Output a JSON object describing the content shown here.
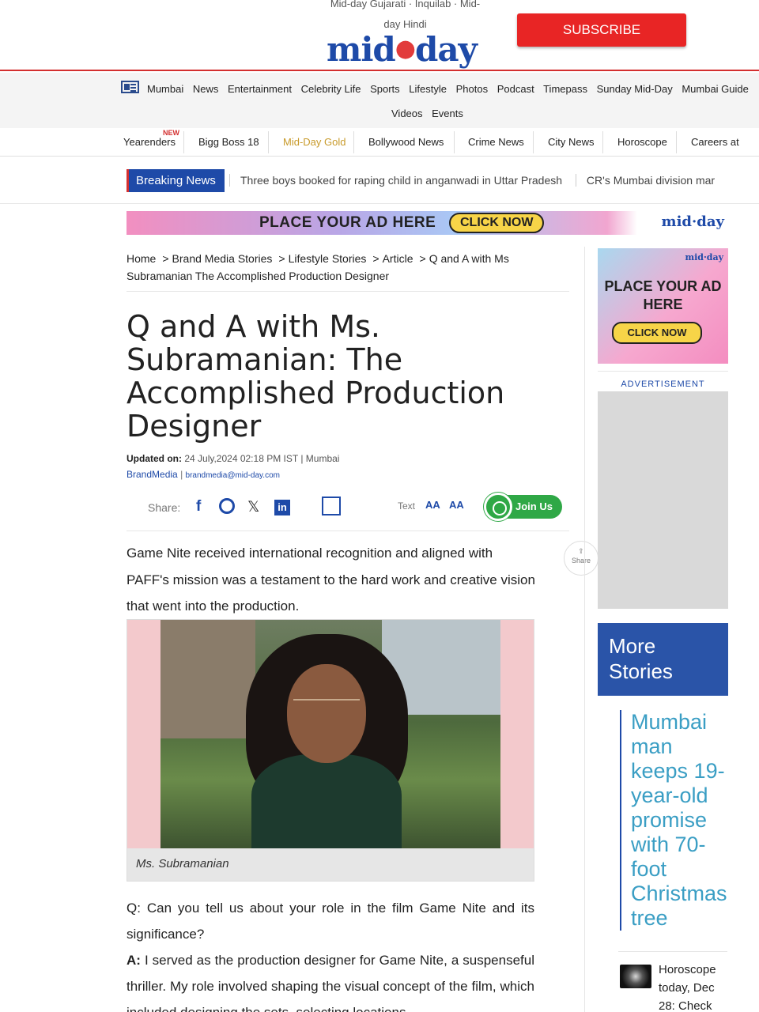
{
  "header": {
    "top_links": "Mid-day Gujarati · Inquilab · Mid-day Hindi",
    "logo_left": "mid",
    "logo_right": "day",
    "subscribe": "SUBSCRIBE"
  },
  "nav_primary": [
    "Mumbai",
    "News",
    "Entertainment",
    "Celebrity Life",
    "Sports",
    "Lifestyle",
    "Photos",
    "Podcast",
    "Timepass",
    "Sunday Mid-Day",
    "Mumbai Guide"
  ],
  "nav_primary_row2": [
    "Videos",
    "Events"
  ],
  "nav_secondary": {
    "new_badge": "NEW",
    "items": [
      "Yearenders",
      "Bigg Boss 18",
      "Mid-Day Gold",
      "Bollywood News",
      "Crime News",
      "City News",
      "Horoscope",
      "Careers at"
    ]
  },
  "breaking": {
    "label": "Breaking News",
    "items": [
      "Three boys booked for raping child in anganwadi in Uttar Pradesh",
      "CR's Mumbai division mar"
    ]
  },
  "ad_banner": {
    "text": "PLACE YOUR AD HERE",
    "cta": "CLICK NOW",
    "brand": "mid·day"
  },
  "breadcrumb": [
    "Home",
    "Brand Media Stories",
    "Lifestyle Stories",
    "Article",
    "Q and A with Ms Subramanian The Accomplished Production Designer"
  ],
  "article": {
    "title": "Q and A with Ms. Subramanian: The Accomplished Production Designer",
    "updated_label": "Updated on:",
    "updated_value": "24 July,2024 02:18 PM IST",
    "location": "Mumbai",
    "author": "BrandMedia",
    "author_email": "brandmedia@mid-day.com",
    "share_label": "Share:",
    "text_label": "Text",
    "font_small": "AA",
    "font_large": "AA",
    "join_label": "Join Us",
    "side_share": "Share",
    "lead": "Game Nite received international recognition and aligned with PAFF's mission was a testament to the hard work and creative vision that went into the production.",
    "caption": "Ms. Subramanian",
    "question": "Q: Can you tell us about your role in the film Game Nite and its significance?",
    "answer_label": "A:",
    "answer": "I served as the production designer for Game Nite, a suspenseful thriller. My role involved shaping the visual concept of the film, which included designing the sets, selecting locations"
  },
  "sidebar": {
    "ad_brand": "mid·day",
    "ad_text": "PLACE YOUR AD HERE",
    "ad_cta": "CLICK NOW",
    "advertisement_label": "ADVERTISEMENT",
    "more_stories": "More Stories",
    "story1": "Mumbai man keeps 19-year-old promise with 70-foot Christmas tree",
    "story2": "Horoscope today, Dec 28: Check"
  },
  "colors": {
    "brand_blue": "#1e4aa8",
    "accent_red": "#e82525",
    "link_teal": "#3a9ec4"
  }
}
